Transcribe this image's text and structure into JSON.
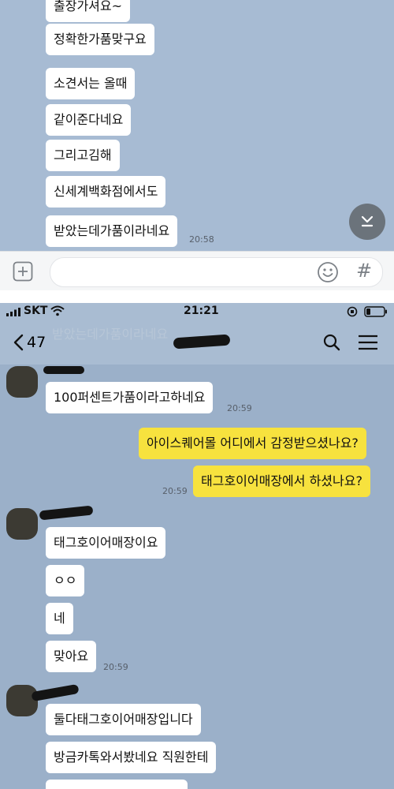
{
  "top_chat": {
    "messages": [
      {
        "text": "출장가셔요~"
      },
      {
        "text": "정확한가품맞구요"
      },
      {
        "text": "소견서는 올때"
      },
      {
        "text": "같이준다네요"
      },
      {
        "text": "그리고김해"
      },
      {
        "text": "신세계백화점에서도"
      },
      {
        "text": "받았는데가품이라네요"
      }
    ],
    "last_time": "20:58"
  },
  "status_bar": {
    "carrier": "SKT",
    "time": "21:21"
  },
  "nav": {
    "back_count": "47",
    "back_glyph": "<"
  },
  "faded_header_text": "받았는데가품이라네요",
  "chat": {
    "group1": {
      "message": "100퍼센트가품이라고하네요",
      "time": "20:59"
    },
    "me": {
      "messages": [
        "아이스퀘어몰 어디에서 감정받으셨나요?",
        "태그호이어매장에서 하셨나요?"
      ],
      "time": "20:59"
    },
    "group2": {
      "messages": [
        "태그호이어매장이요",
        "ㅇㅇ",
        "네",
        "맞아요"
      ],
      "time": "20:59"
    },
    "group3": {
      "messages": [
        "둘다태그호이어매장입니다",
        "방금카톡와서봤네요 직원한테"
      ]
    }
  },
  "icons": {
    "plus": "plus-icon",
    "emoji": "emoji-icon",
    "hash": "#",
    "search": "search-icon",
    "menu": "menu-icon",
    "scroll_down": "chevron-down-icon"
  },
  "colors": {
    "chat_bg": "#9bb0c9",
    "my_bubble": "#f7e23e",
    "their_bubble": "#ffffff"
  }
}
